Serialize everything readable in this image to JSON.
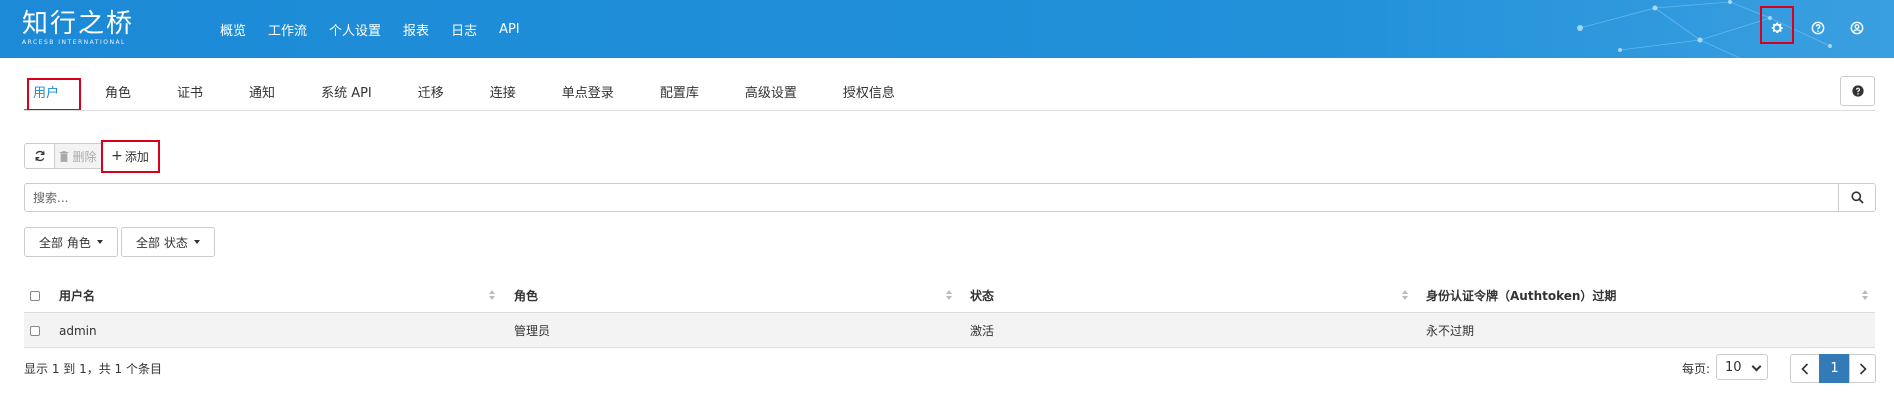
{
  "header": {
    "logo_text": "知行之桥",
    "logo_subtext": "ARCESB INTERNATIONAL",
    "nav": [
      "概览",
      "工作流",
      "个人设置",
      "报表",
      "日志",
      "API"
    ],
    "icons": [
      "gear-icon",
      "help-circle-icon",
      "user-circle-icon"
    ]
  },
  "tabs": [
    "用户",
    "角色",
    "证书",
    "通知",
    "系统 API",
    "迁移",
    "连接",
    "单点登录",
    "配置库",
    "高级设置",
    "授权信息"
  ],
  "toolbar": {
    "delete_label": "删除",
    "add_label": "添加"
  },
  "search": {
    "placeholder": "搜索..."
  },
  "filters": {
    "role": "全部 角色",
    "status": "全部 状态"
  },
  "table": {
    "columns": [
      "用户名",
      "角色",
      "状态",
      "身份认证令牌（Authtoken）过期"
    ],
    "rows": [
      [
        "admin",
        "管理员",
        "激活",
        "永不过期"
      ]
    ]
  },
  "footer": {
    "summary": "显示 1 到 1，共 1 个条目",
    "per_page_label": "每页:",
    "per_page_value": "10",
    "current_page": "1"
  },
  "colors": {
    "header": "#1c8ad6",
    "accent": "#337ab7",
    "highlight": "#d9001b"
  }
}
